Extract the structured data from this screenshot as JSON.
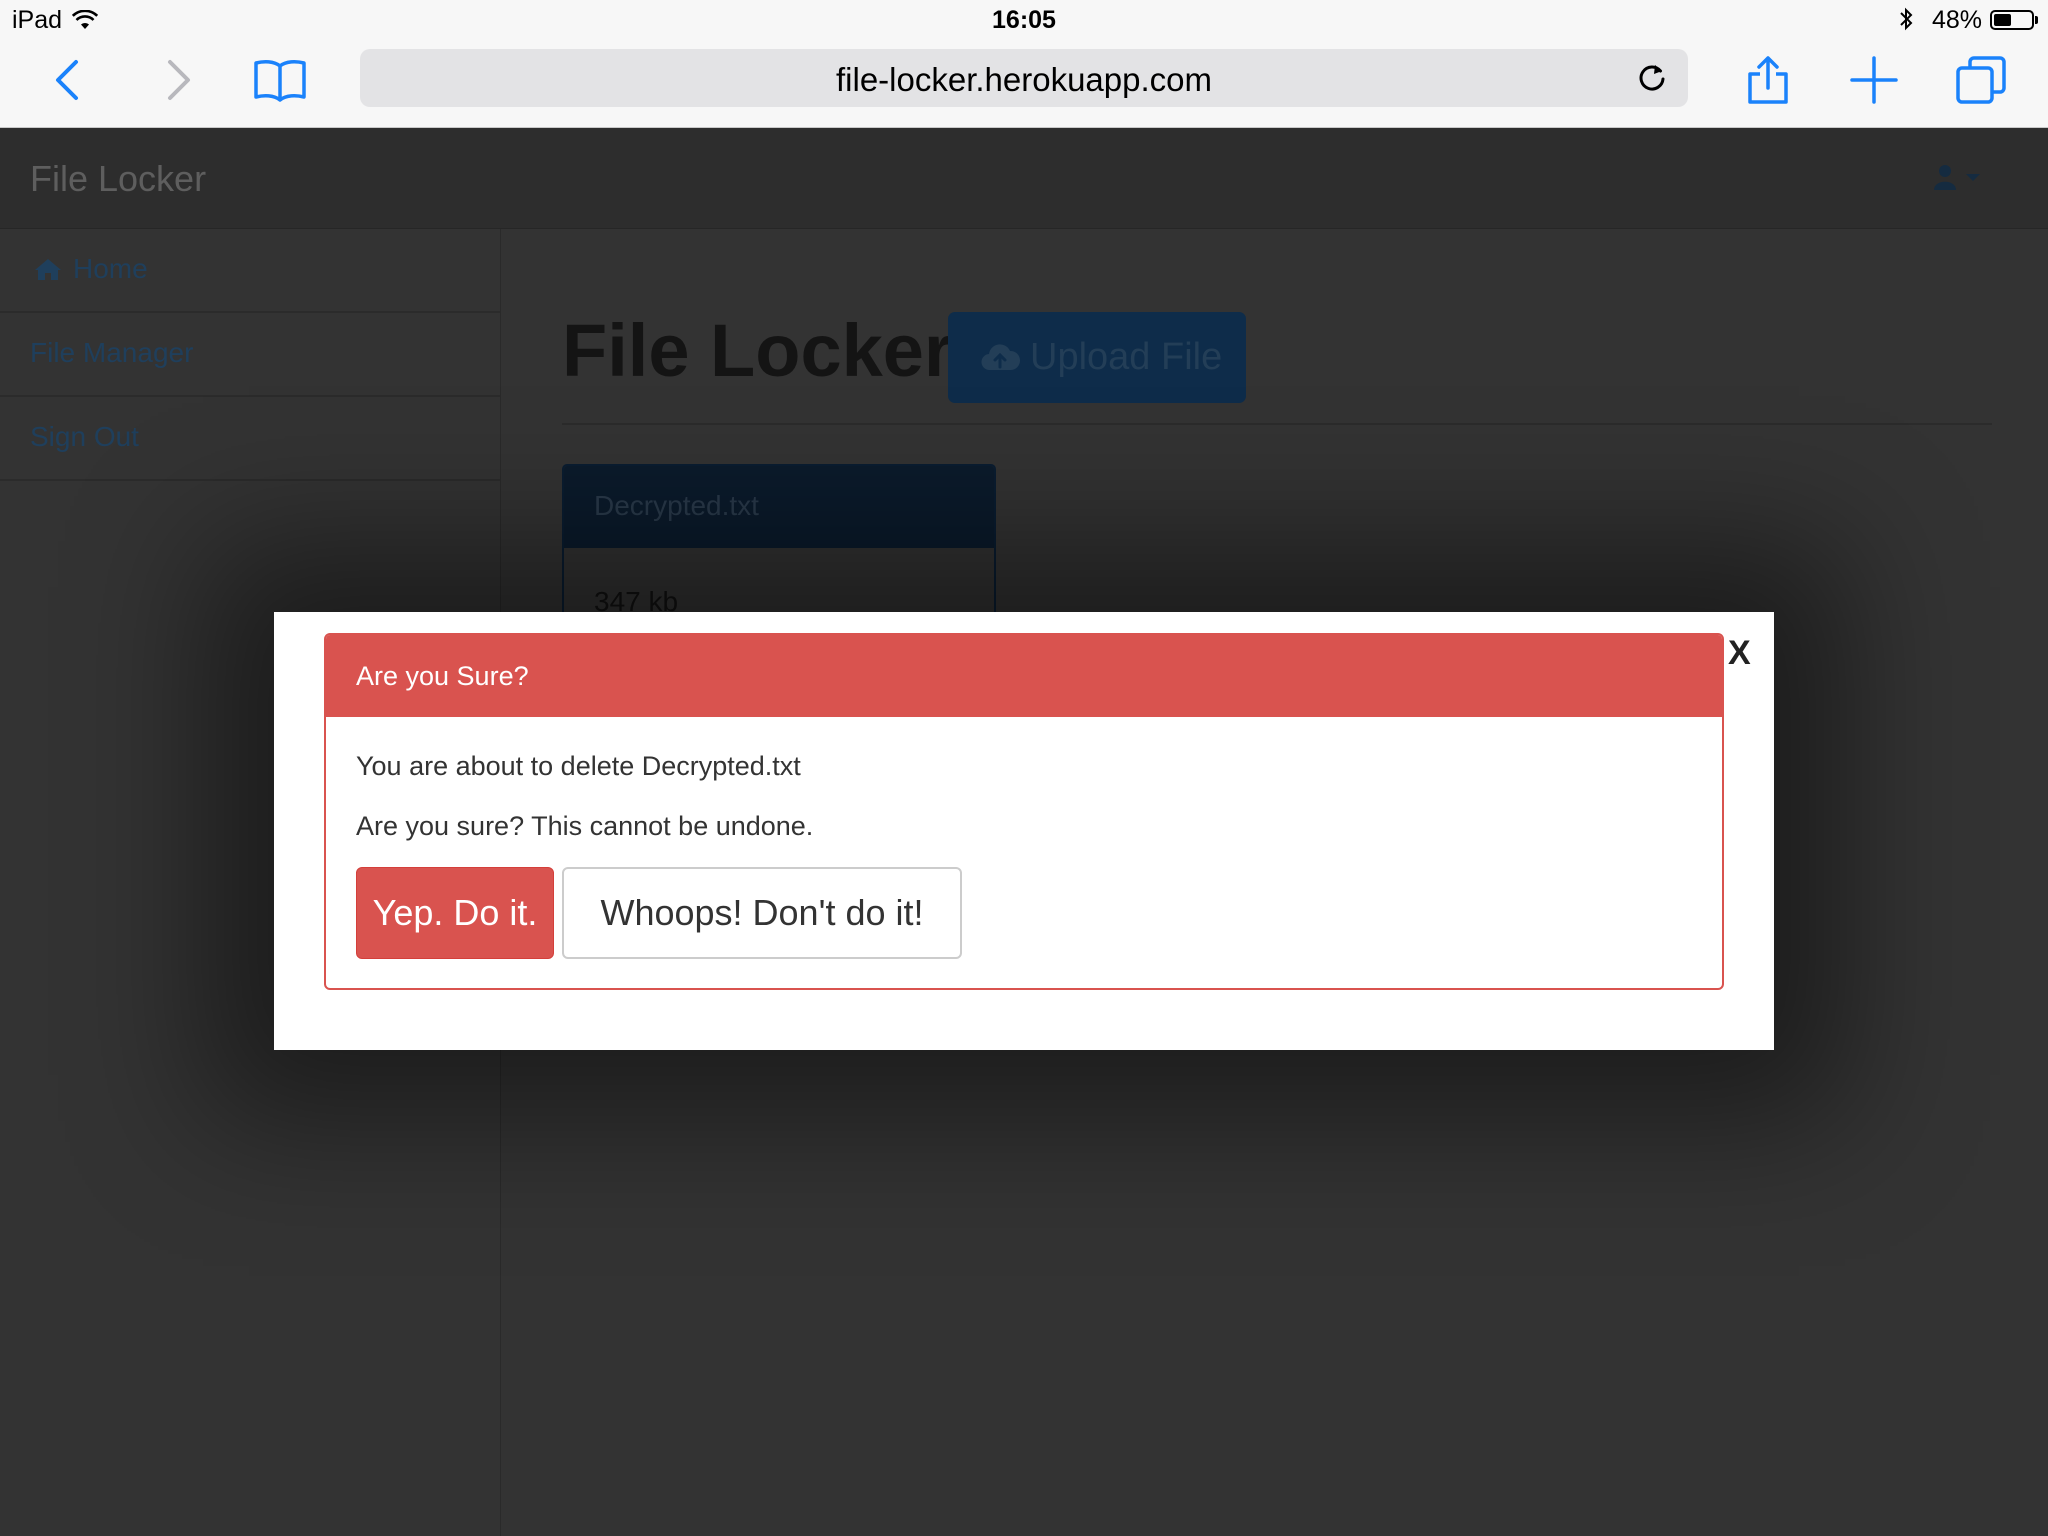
{
  "status_bar": {
    "device": "iPad",
    "time": "16:05",
    "battery_percent": "48%",
    "battery_level": 0.48,
    "icons": [
      "wifi-icon",
      "bluetooth-icon",
      "battery-icon"
    ]
  },
  "browser": {
    "url": "file-locker.herokuapp.com",
    "accent_color": "#1a82fb",
    "icons": [
      "back-icon",
      "forward-icon",
      "bookmarks-icon",
      "reload-icon",
      "share-icon",
      "new-tab-icon",
      "tabs-icon"
    ]
  },
  "app": {
    "brand": "File Locker",
    "nav": [
      {
        "label": "Home",
        "icon": "home-icon"
      },
      {
        "label": "File Manager"
      },
      {
        "label": "Sign Out"
      }
    ],
    "page_title": "File Locker",
    "upload_label": "Upload File",
    "files": [
      {
        "name": "Decrypted.txt",
        "size": "347 kb"
      }
    ]
  },
  "modal": {
    "close_label": "X",
    "title": "Are you Sure?",
    "message": "You are about to delete Decrypted.txt",
    "warning": "Are you sure? This cannot be undone.",
    "confirm_label": "Yep. Do it.",
    "cancel_label": "Whoops! Don't do it!",
    "danger_color": "#d9534f"
  }
}
